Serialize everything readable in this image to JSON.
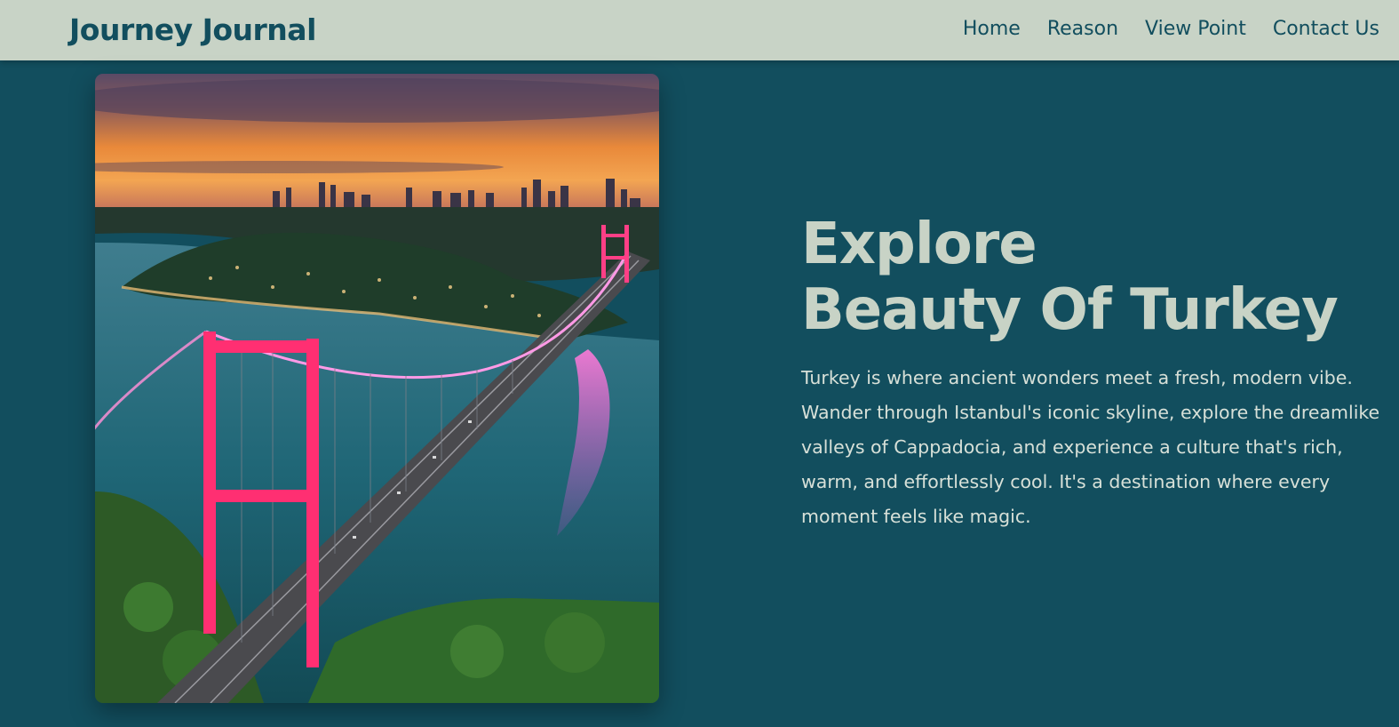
{
  "header": {
    "brand": "Journey Journal",
    "nav": [
      "Home",
      "Reason",
      "View Point",
      "Contact Us"
    ]
  },
  "hero": {
    "image_alt": "Illuminated suspension bridge over the Bosphorus at sunset with Istanbul skyline",
    "title_line1": "Explore",
    "title_line2": "Beauty Of Turkey",
    "description": "Turkey is where ancient wonders meet a fresh, modern vibe. Wander through Istanbul's iconic skyline, explore the dreamlike valleys of Cappadocia, and experience a culture that's rich, warm, and effortlessly cool. It's a destination where every moment feels like magic."
  },
  "colors": {
    "background": "#124e5e",
    "navbar": "#c8d3c6",
    "accent_text": "#c8d3c6"
  }
}
